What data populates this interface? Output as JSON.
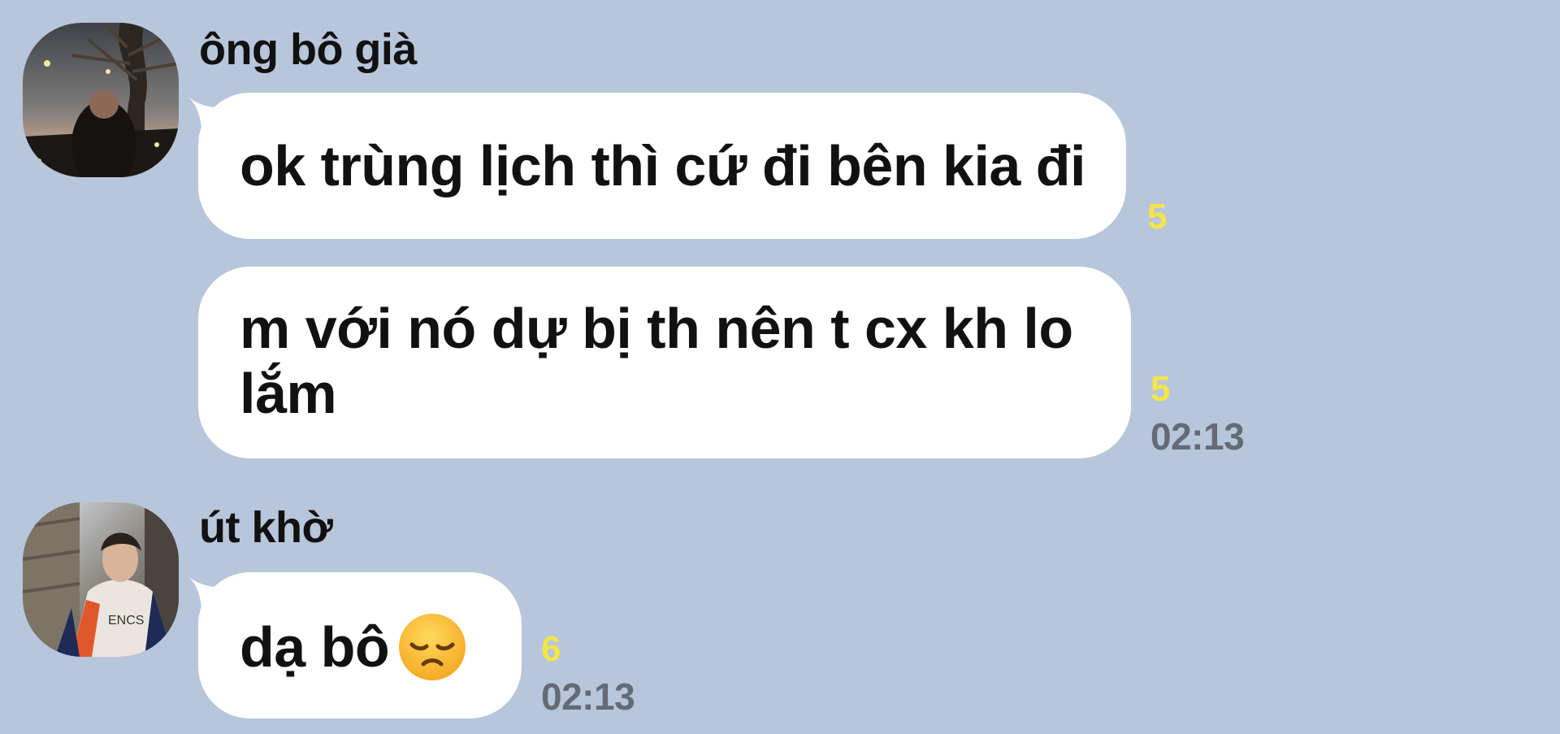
{
  "theme": {
    "background": "#b7c6da",
    "bubble": "#ffffff",
    "read_count_color": "#f3e54a",
    "time_color": "#626b76"
  },
  "groups": [
    {
      "sender": "ông bô già",
      "avatar_icon": "profile-photo-tree-night",
      "messages": [
        {
          "text": "ok trùng lịch thì cứ đi bên kia đi",
          "read_count": "5",
          "time": ""
        },
        {
          "text_lines": [
            "m với nó dự bị th nên t cx kh lo",
            "lắm"
          ],
          "read_count": "5",
          "time": "02:13"
        }
      ]
    },
    {
      "sender": "út khờ",
      "avatar_icon": "profile-photo-man-jacket",
      "messages": [
        {
          "text": "dạ bô",
          "emoji": "disappointed-face-icon",
          "read_count": "6",
          "time": "02:13"
        }
      ]
    }
  ]
}
